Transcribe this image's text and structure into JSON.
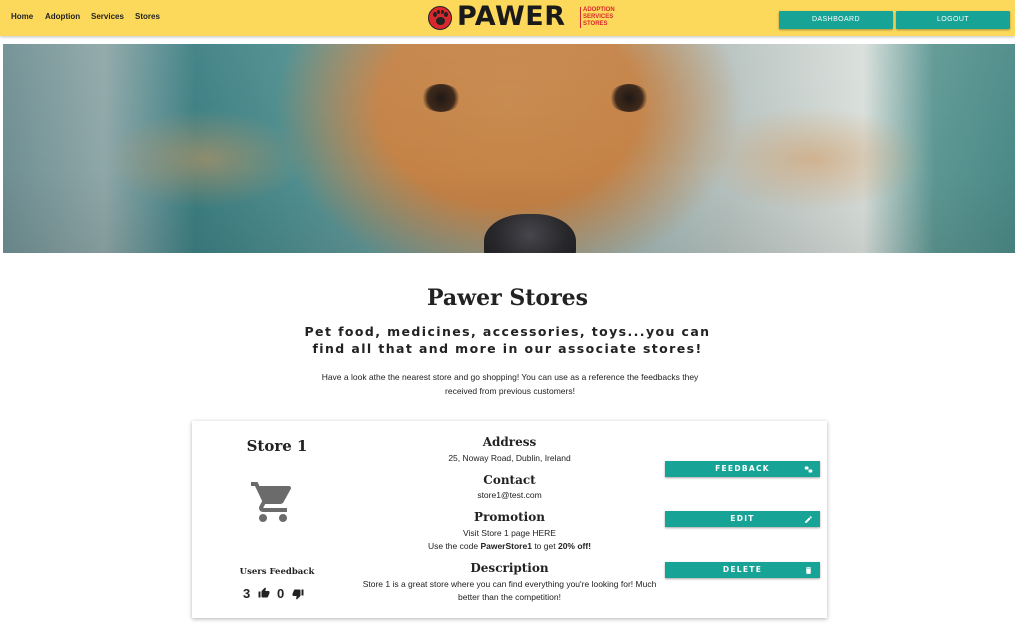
{
  "nav": {
    "links": [
      "Home",
      "Adoption",
      "Services",
      "Stores"
    ],
    "logo_text": "PAWER",
    "logo_sub": [
      "ADOPTION",
      "SERVICES",
      "STORES"
    ],
    "dashboard_label": "DASHBOARD",
    "logout_label": "LOGOUT"
  },
  "hero": {
    "image": "golden-retriever-puppy-photo"
  },
  "main": {
    "title": "Pawer Stores",
    "subtitle": "Pet food, medicines, accessories, toys...you can find all that and more in our associate stores!",
    "intro": "Have a look athe the nearest store and go shopping! You can use as a reference the feedbacks they received from previous customers!"
  },
  "store": {
    "name": "Store 1",
    "icon": "shopping-cart-icon",
    "feedback_label": "Users Feedback",
    "likes": "3",
    "dislikes": "0",
    "address_label": "Address",
    "address": "25, Noway Road, Dublin, Ireland",
    "contact_label": "Contact",
    "email": "store1@test.com",
    "promotion_label": "Promotion",
    "promotion_line1": "Visit Store 1 page HERE",
    "promotion_prefix": "Use the code",
    "promotion_code": "PawerStore1",
    "promotion_middle": "to get",
    "promotion_discount": "20% off!",
    "description_label": "Description",
    "description": "Store 1 is a great store where you can find everything you're looking for! Much better than the competition!",
    "buttons": {
      "feedback": "FEEDBACK",
      "edit": "EDIT",
      "delete": "DELETE"
    }
  },
  "colors": {
    "navbar": "#fcd95a",
    "accent": "#17a396",
    "logo_red": "#d8282e"
  }
}
